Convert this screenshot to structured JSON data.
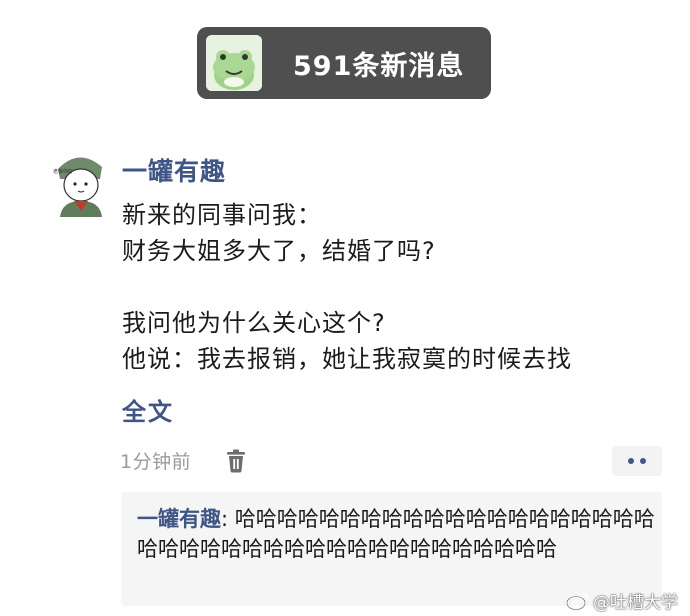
{
  "notification": {
    "text": "591条新消息"
  },
  "post": {
    "author": "一罐有趣",
    "avatar_label": "老板你好",
    "lines": [
      "新来的同事问我：",
      "财务大姐多大了，结婚了吗?",
      "",
      "我问他为什么关心这个?",
      "他说：我去报销，她让我寂寞的时候去找"
    ],
    "full_text_link": "全文",
    "time": "1分钟前"
  },
  "reply": {
    "author": "一罐有趣",
    "separator": ": ",
    "text": "哈哈哈哈哈哈哈哈哈哈哈哈哈哈哈哈哈哈哈哈哈哈哈哈哈哈哈哈哈哈哈哈哈哈哈哈哈哈哈哈"
  },
  "watermark": {
    "text": "@吐槽大学"
  },
  "icons": {
    "banner_avatar": "frog-avatar-icon",
    "trash": "trash-icon",
    "more": "more-dots-icon",
    "weibo": "weibo-icon"
  },
  "colors": {
    "banner_bg": "#4f4f4f",
    "link_blue": "#3e5585",
    "timestamp_gray": "#9b9b9b",
    "reply_bg": "#f5f5f5"
  }
}
